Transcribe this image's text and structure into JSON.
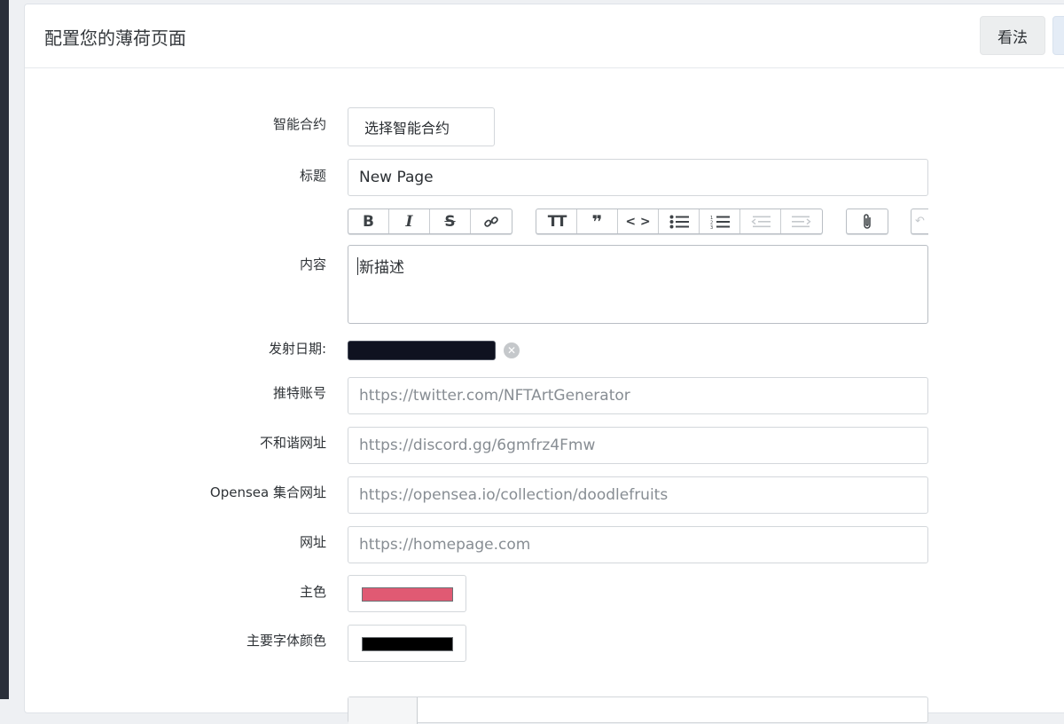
{
  "header": {
    "title": "配置您的薄荷页面",
    "view_button": "看法"
  },
  "form": {
    "contract": {
      "label": "智能合约",
      "button": "选择智能合约"
    },
    "title": {
      "label": "标题",
      "value": "New Page"
    },
    "content": {
      "label": "内容",
      "value": "新描述"
    },
    "launch_date": {
      "label": "发射日期:"
    },
    "twitter": {
      "label": "推特账号",
      "placeholder": "https://twitter.com/NFTArtGenerator"
    },
    "discord": {
      "label": "不和谐网址",
      "placeholder": "https://discord.gg/6gmfrz4Fmw"
    },
    "opensea": {
      "label": "Opensea 集合网址",
      "placeholder": "https://opensea.io/collection/doodlefruits"
    },
    "website": {
      "label": "网址",
      "placeholder": "https://homepage.com"
    },
    "primary_color": {
      "label": "主色",
      "value": "#e05a73"
    },
    "primary_font_color": {
      "label": "主要字体颜色",
      "value": "#000000"
    }
  },
  "toolbar": {
    "groups": [
      [
        "bold-icon",
        "italic-icon",
        "strikethrough-icon",
        "link-icon"
      ],
      [
        "heading-icon",
        "quote-icon",
        "code-icon",
        "bullet-list-icon",
        "numbered-list-icon",
        "outdent-icon",
        "indent-icon"
      ],
      [
        "attachment-icon"
      ],
      [
        "undo-icon"
      ]
    ]
  },
  "colors": {
    "page_bg": "#eef0f3",
    "rail": "#2a2f3a",
    "date_input": "#0f1220"
  }
}
